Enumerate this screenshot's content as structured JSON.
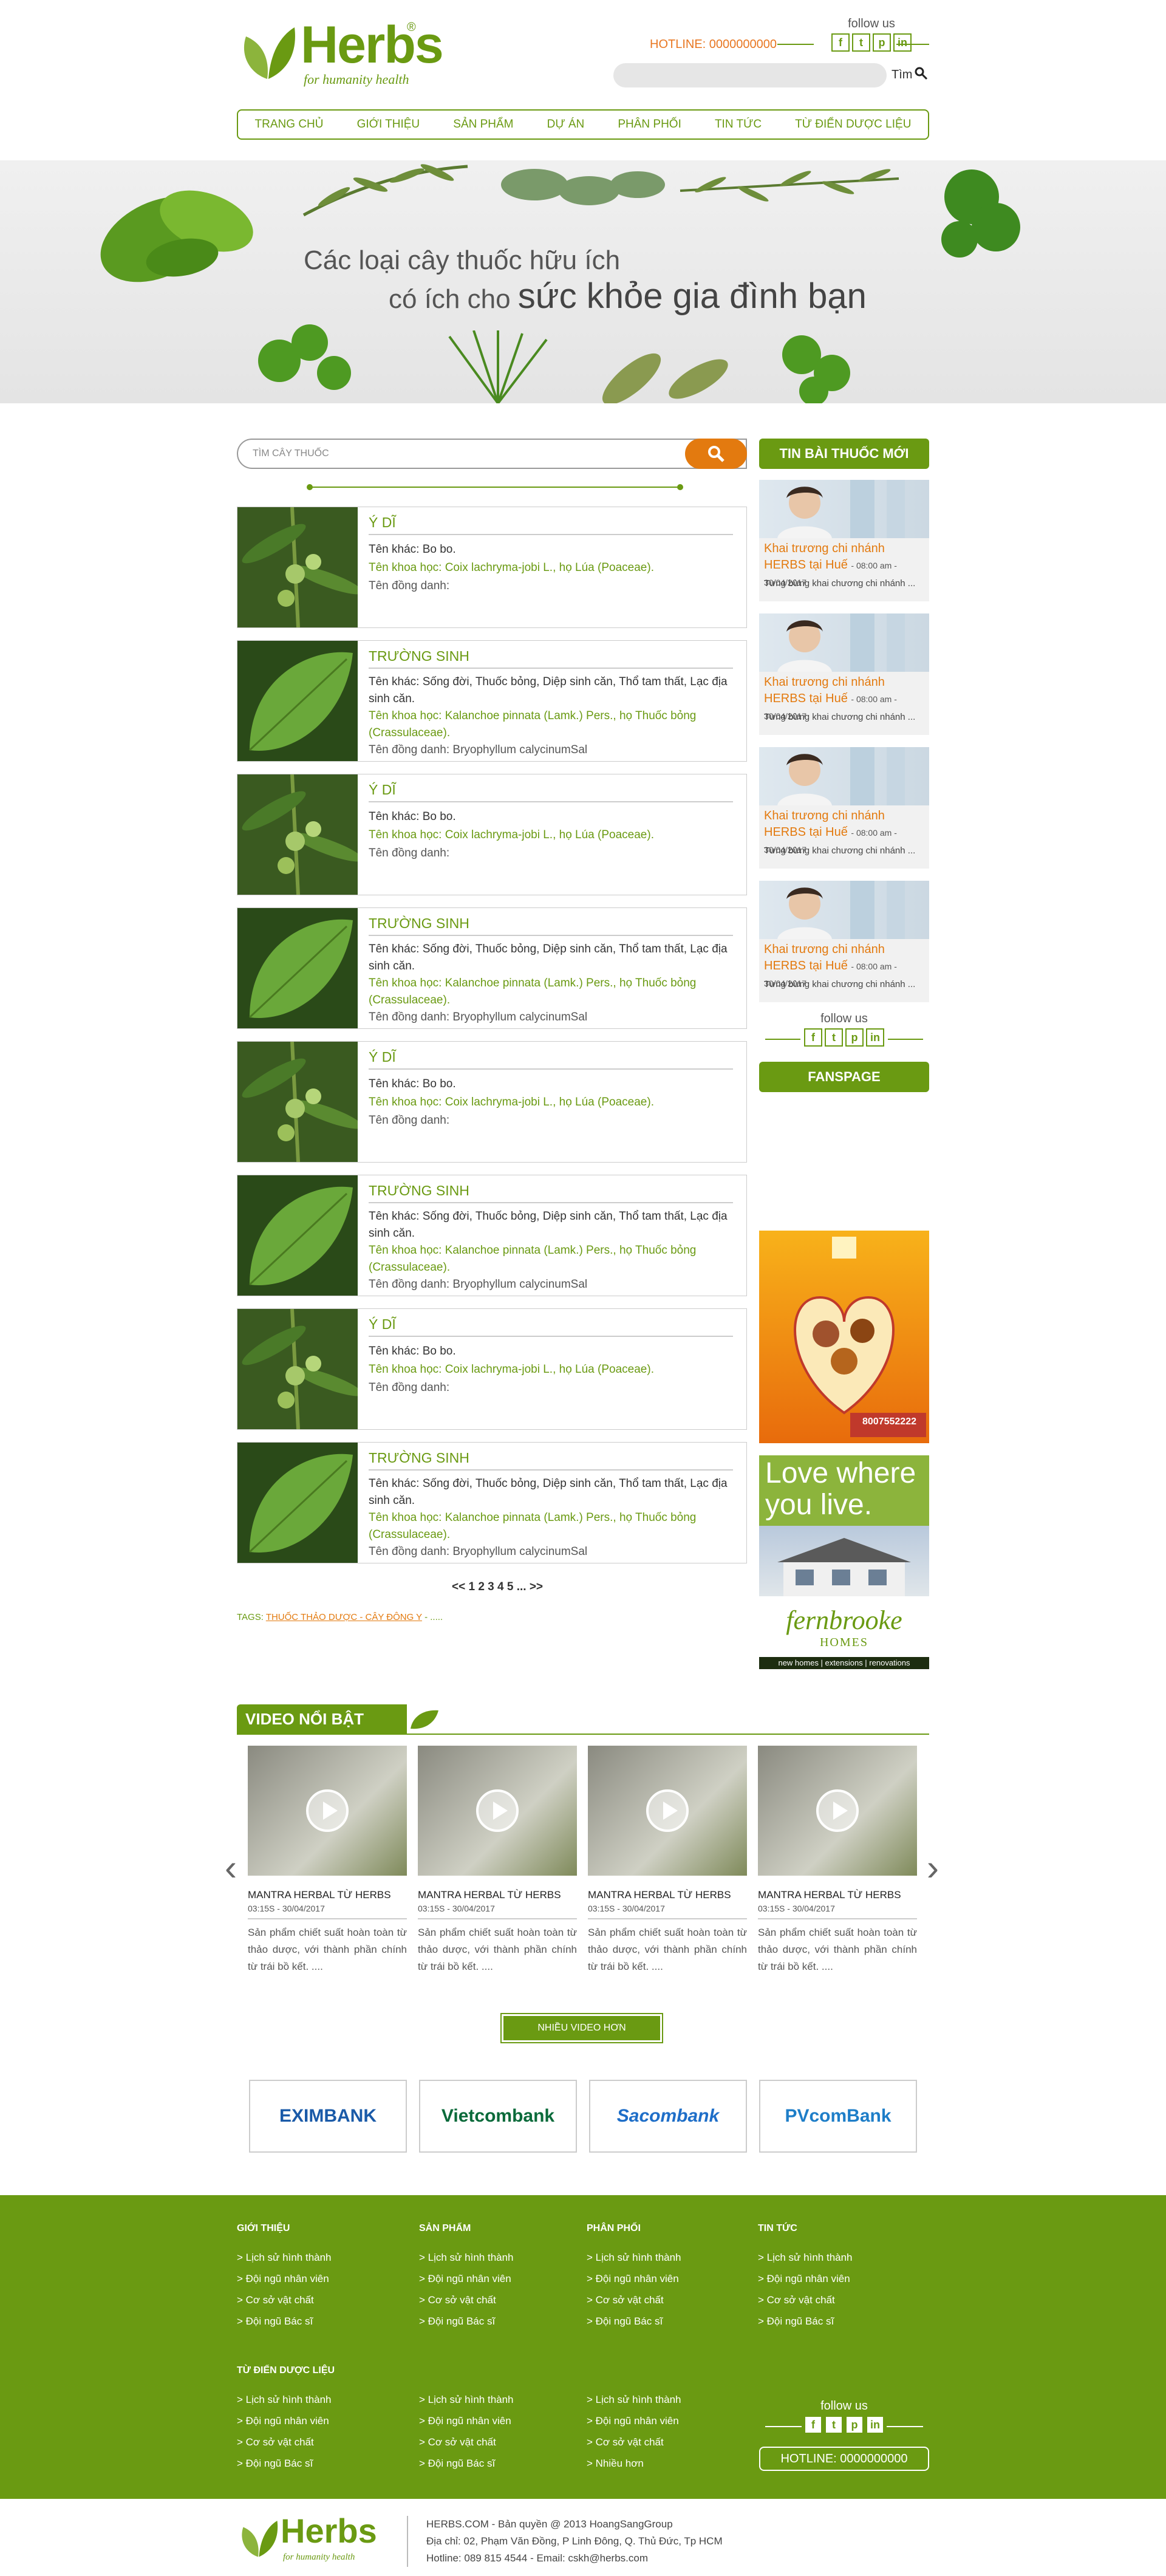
{
  "header": {
    "logo_text": "Herbs",
    "logo_reg": "®",
    "logo_tagline": "for humanity health",
    "hotline": "HOTLINE: 0000000000",
    "follow_label": "follow us",
    "socials": [
      "f",
      "t",
      "p",
      "in"
    ],
    "search_button": "Tìm"
  },
  "nav": {
    "items": [
      "TRANG CHỦ",
      "GIỚI THIỆU",
      "SẢN PHẨM",
      "DỰ ÁN",
      "PHÂN PHỐI",
      "TIN TỨC",
      "TỪ ĐIỂN DƯỢC LIỆU"
    ]
  },
  "banner": {
    "line1": "Các loại cây thuốc hữu ích",
    "line2_prefix": "có ích cho",
    "line2_big": "sức khỏe gia đình bạn"
  },
  "search": {
    "placeholder": "TÌM CÂY THUỐC"
  },
  "herbs": [
    {
      "title": "Ý DĨ",
      "other": "Tên khác: Bo bo.",
      "science": "Tên khoa học: Coix lachryma-jobi L., họ Lúa (Poaceae).",
      "synonym": "Tên đồng danh:"
    },
    {
      "title": "TRƯỜNG SINH",
      "other": "Tên khác: Sống đời, Thuốc bỏng, Diệp sinh căn, Thổ tam thất, Lạc địa sinh căn.",
      "science": "Tên khoa học: Kalanchoe pinnata (Lamk.) Pers., họ Thuốc bỏng (Crassulaceae).",
      "synonym": "Tên đồng danh: Bryophyllum calycinumSal"
    },
    {
      "title": "Ý DĨ",
      "other": "Tên khác: Bo bo.",
      "science": "Tên khoa học: Coix lachryma-jobi L., họ Lúa (Poaceae).",
      "synonym": "Tên đồng danh:"
    },
    {
      "title": "TRƯỜNG SINH",
      "other": "Tên khác: Sống đời, Thuốc bỏng, Diệp sinh căn, Thổ tam thất, Lạc địa sinh căn.",
      "science": "Tên khoa học: Kalanchoe pinnata (Lamk.) Pers., họ Thuốc bỏng (Crassulaceae).",
      "synonym": "Tên đồng danh: Bryophyllum calycinumSal"
    },
    {
      "title": "Ý DĨ",
      "other": "Tên khác: Bo bo.",
      "science": "Tên khoa học: Coix lachryma-jobi L., họ Lúa (Poaceae).",
      "synonym": "Tên đồng danh:"
    },
    {
      "title": "TRƯỜNG SINH",
      "other": "Tên khác: Sống đời, Thuốc bỏng, Diệp sinh căn, Thổ tam thất, Lạc địa sinh căn.",
      "science": "Tên khoa học: Kalanchoe pinnata (Lamk.) Pers., họ Thuốc bỏng (Crassulaceae).",
      "synonym": "Tên đồng danh: Bryophyllum calycinumSal"
    },
    {
      "title": "Ý DĨ",
      "other": "Tên khác: Bo bo.",
      "science": "Tên khoa học: Coix lachryma-jobi L., họ Lúa (Poaceae).",
      "synonym": "Tên đồng danh:"
    },
    {
      "title": "TRƯỜNG SINH",
      "other": "Tên khác: Sống đời, Thuốc bỏng, Diệp sinh căn, Thổ tam thất, Lạc địa sinh căn.",
      "science": "Tên khoa học: Kalanchoe pinnata (Lamk.) Pers., họ Thuốc bỏng (Crassulaceae).",
      "synonym": "Tên đồng danh: Bryophyllum calycinumSal"
    }
  ],
  "pagination": "<< 1 2 3 4 5 ... >>",
  "tags": {
    "label": "TAGS:",
    "values": "THUỐC THẢO DƯỢC - CÂY ĐÔNG Y",
    "rest": "- ....."
  },
  "sidebar": {
    "news_header": "TIN BÀI THUỐC MỚI",
    "news": [
      {
        "title": "Khai trương chi nhánh HERBS tại Huế",
        "date": "- 08:00 am - 30/04/2017",
        "desc": "Tưng bừng khai chương chi nhánh ..."
      },
      {
        "title": "Khai trương chi nhánh HERBS tại Huế",
        "date": "- 08:00 am - 30/04/2017",
        "desc": "Tưng bừng khai chương chi nhánh ..."
      },
      {
        "title": "Khai trương chi nhánh HERBS tại Huế",
        "date": "- 08:00 am - 30/04/2017",
        "desc": "Tưng bừng khai chương chi nhánh ..."
      },
      {
        "title": "Khai trương chi nhánh HERBS tại Huế",
        "date": "- 08:00 am - 30/04/2017",
        "desc": "Tưng bừng khai chương chi nhánh ..."
      }
    ],
    "follow_label": "follow us",
    "fanspage": "FANSPAGE",
    "ad2_headline": "Love where you live.",
    "ad2_brand": "fernbrooke",
    "ad2_brand_sub": "HOMES",
    "ad2_bar": "new homes | extensions | renovations",
    "ad1_phone": "8007552222"
  },
  "videos": {
    "header": "VIDEO NỔI BẬT",
    "items": [
      {
        "title": "MANTRA HERBAL TỪ HERBS",
        "date": "03:15S - 30/04/2017",
        "desc": "Sản phẩm chiết suất hoàn toàn từ thảo dược, với thành phần chính từ trái bồ kết. ...."
      },
      {
        "title": "MANTRA HERBAL TỪ HERBS",
        "date": "03:15S - 30/04/2017",
        "desc": "Sản phẩm chiết suất hoàn toàn từ thảo dược, với thành phần chính từ trái bồ kết. ...."
      },
      {
        "title": "MANTRA HERBAL TỪ HERBS",
        "date": "03:15S - 30/04/2017",
        "desc": "Sản phẩm chiết suất hoàn toàn từ thảo dược, với thành phần chính từ trái bồ kết. ...."
      },
      {
        "title": "MANTRA HERBAL TỪ HERBS",
        "date": "03:15S - 30/04/2017",
        "desc": "Sản phẩm chiết suất hoàn toàn từ thảo dược, với thành phần chính từ trái bồ kết. ...."
      }
    ],
    "more": "NHIỀU VIDEO HƠN"
  },
  "banks": [
    {
      "name": "EXIMBANK",
      "color": "#1a5aa8"
    },
    {
      "name": "Vietcombank",
      "color": "#0a6a3a"
    },
    {
      "name": "Sacombank",
      "color": "#1e6ec8"
    },
    {
      "name": "PVcomBank",
      "color": "#1e7ec8"
    }
  ],
  "footer": {
    "columns": [
      {
        "title": "GIỚI THIỆU",
        "items": [
          "> Lịch sử hình thành",
          "> Đội ngũ nhân viên",
          "> Cơ sở vật chất",
          "> Đội ngũ Bác sĩ"
        ]
      },
      {
        "title": "SẢN PHẨM",
        "items": [
          "> Lịch sử hình thành",
          "> Đội ngũ nhân viên",
          "> Cơ sở vật chất",
          "> Đội ngũ Bác sĩ"
        ]
      },
      {
        "title": "PHÂN PHỐI",
        "items": [
          "> Lịch sử hình thành",
          "> Đội ngũ nhân viên",
          "> Cơ sở vật chất",
          "> Đội ngũ Bác sĩ"
        ]
      },
      {
        "title": "TIN TỨC",
        "items": [
          "> Lịch sử hình thành",
          "> Đội ngũ nhân viên",
          "> Cơ sở vật chất",
          "> Đội ngũ Bác sĩ"
        ]
      },
      {
        "title": "TỪ ĐIỂN DƯỢC LIỆU",
        "items": [
          "> Lịch sử hình thành",
          "> Đội ngũ nhân viên",
          "> Cơ sở vật chất",
          "> Đội ngũ Bác sĩ"
        ]
      },
      {
        "title": "",
        "items": [
          "> Lịch sử hình thành",
          "> Đội ngũ nhân viên",
          "> Cơ sở vật chất",
          "> Đội ngũ Bác sĩ"
        ]
      },
      {
        "title": "",
        "items": [
          "> Lịch sử hình thành",
          "> Đội ngũ nhân viên",
          "> Cơ sở vật chất",
          "> Nhiều hơn"
        ]
      }
    ],
    "follow_label": "follow us",
    "hotline": "HOTLINE: 0000000000"
  },
  "bottom": {
    "copyright": "HERBS.COM - Bản quyền @ 2013 HoangSangGroup",
    "address": "Địa chỉ: 02, Phạm Văn Đồng, P Linh Đông, Q. Thủ Đức, Tp HCM",
    "contact": "Hotline: 089 815 4544 - Email: cskh@herbs.com"
  },
  "colors": {
    "primary": "#6a9a12",
    "accent": "#e37a0f"
  }
}
